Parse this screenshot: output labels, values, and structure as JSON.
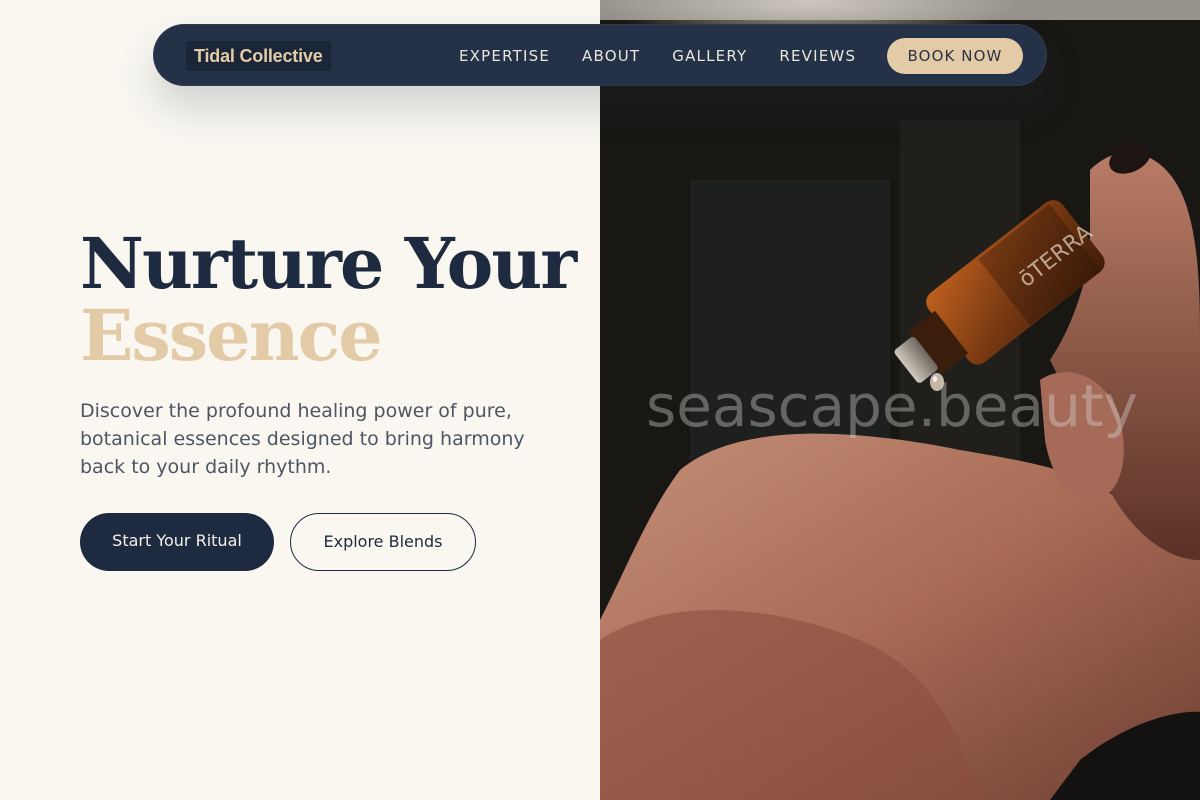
{
  "nav": {
    "brand": "Tidal Collective",
    "links": [
      "EXPERTISE",
      "ABOUT",
      "GALLERY",
      "REVIEWS"
    ],
    "cta": "BOOK NOW"
  },
  "hero": {
    "headline_line1": "Nurture Your",
    "headline_line2": "Essence",
    "subtext": "Discover the profound healing power of pure, botanical essences designed to bring harmony back to your daily rhythm.",
    "primary_button": "Start Your Ritual",
    "secondary_button": "Explore Blends"
  },
  "image": {
    "watermark": "seascape.beauty",
    "bottle_label": "ōTERRA"
  },
  "colors": {
    "navy": "#1e2a3f",
    "sand": "#e3cba8",
    "cream": "#f9f7f0",
    "nav_bg": "#243147"
  }
}
